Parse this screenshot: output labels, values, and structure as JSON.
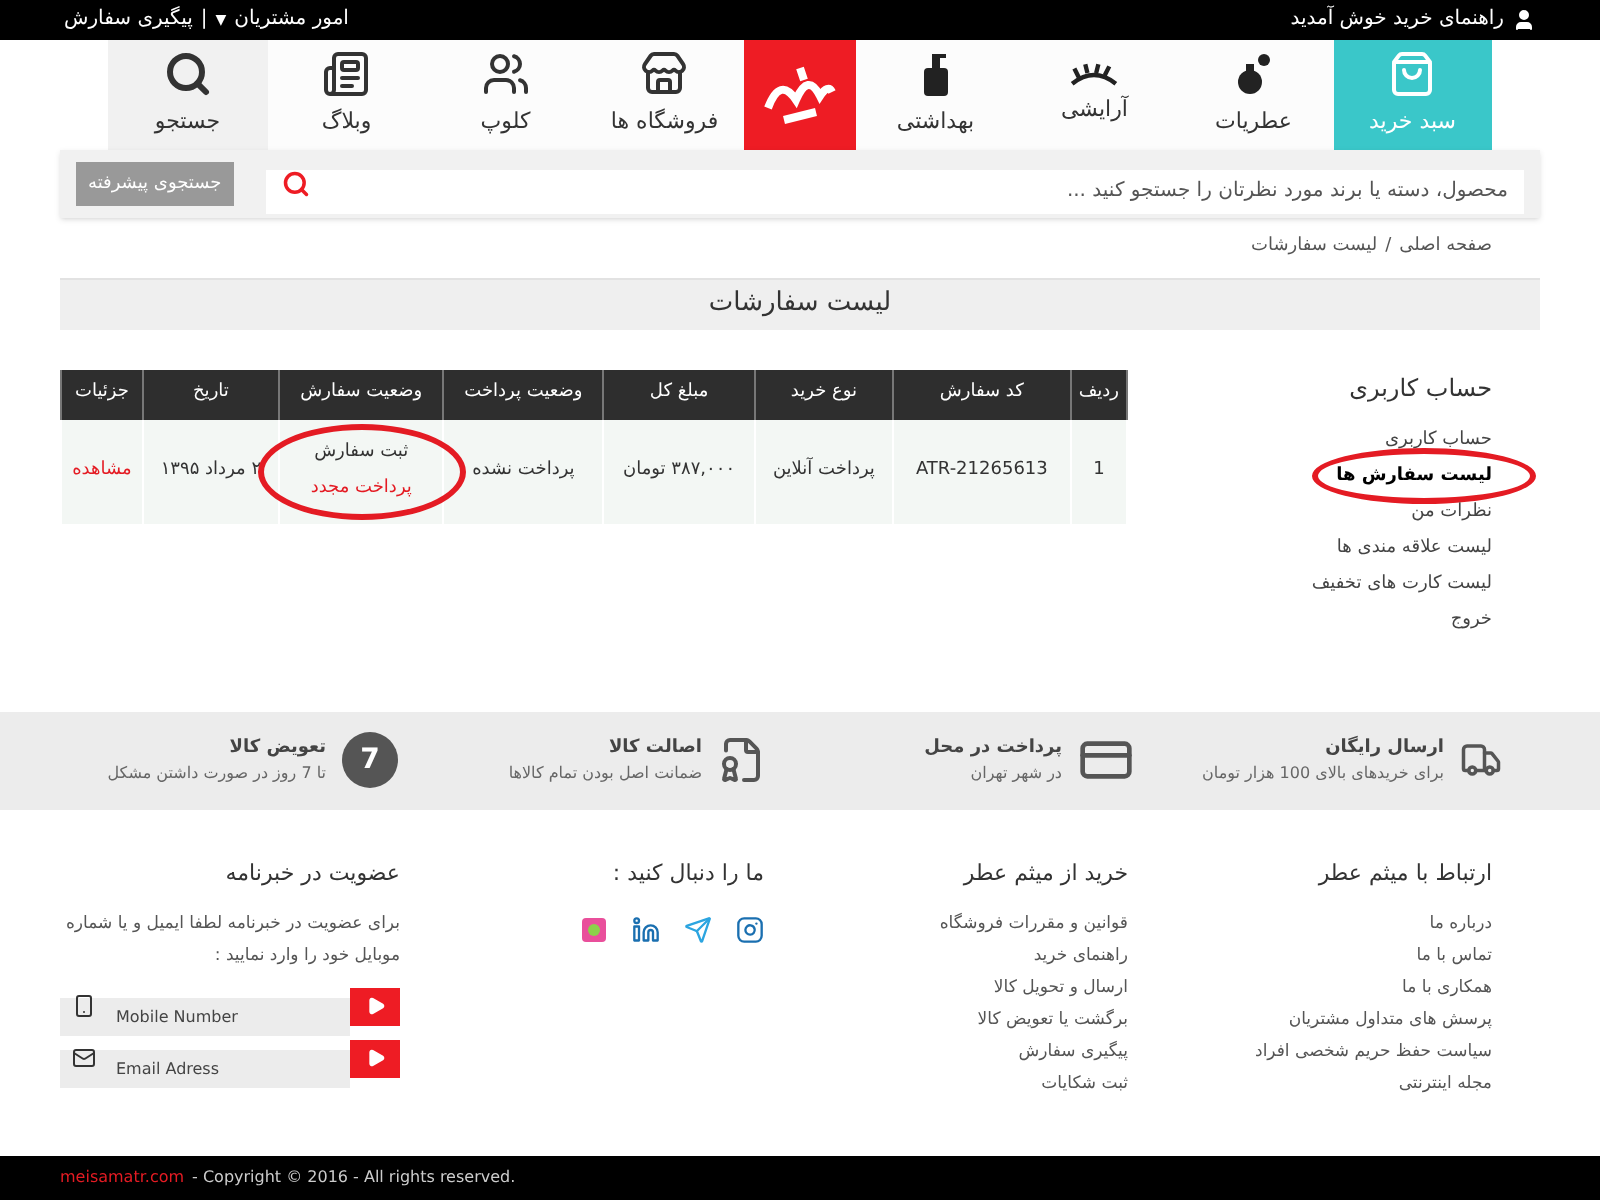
{
  "top_bar": {
    "welcome": "راهنمای خرید خوش آمدید",
    "menu": "امور مشتریان",
    "caret": "▼",
    "separator": "|",
    "track": "پیگیری سفارش"
  },
  "nav": [
    {
      "kind": "item",
      "label": "سبد خرید",
      "selected": true
    },
    {
      "kind": "item",
      "label": "عطریات",
      "selected": false
    },
    {
      "kind": "item",
      "label": "آرایشی",
      "selected": false
    },
    {
      "kind": "item",
      "label": "بهداشتی",
      "selected": false
    },
    {
      "kind": "logo"
    },
    {
      "kind": "item",
      "label": "فروشگاه ها",
      "selected": false
    },
    {
      "kind": "item",
      "label": "کلوپ",
      "selected": false
    },
    {
      "kind": "item",
      "label": "وبلاگ",
      "selected": false
    },
    {
      "kind": "item",
      "label": "جستجو",
      "selected": false
    }
  ],
  "search": {
    "placeholder": "محصول، دسته یا برند مورد نظرتان را جستجو کنید ...",
    "advanced": "جستجوی پیشرفته"
  },
  "breadcrumb": {
    "home": "صفحه اصلی",
    "separator": "/",
    "current": "لیست سفارشات"
  },
  "page_title": "لیست سفارشات",
  "table": {
    "columns": [
      "ردیف",
      "کد سفارش",
      "نوع خرید",
      "مبلغ کل",
      "وضعیت پرداخت",
      "وضعیت سفارش",
      "تاریخ",
      "جزئیات"
    ],
    "rows": [
      {
        "index": "1",
        "code": "ATR-21265613",
        "type": "پرداخت آنلاین",
        "total": "۳۸۷,۰۰۰ تومان",
        "payment": "پرداخت نشده",
        "status": "ثبت سفارش",
        "repay": "پرداخت مجدد",
        "date": "۲ مرداد ۱۳۹۵",
        "details": "مشاهده"
      }
    ]
  },
  "sidebar": {
    "title": "حساب کاربری",
    "items": [
      {
        "label": "حساب کاربری",
        "selected": false
      },
      {
        "label": "لیست سفارش ها",
        "selected": true
      },
      {
        "label": "نظرات من",
        "selected": false
      },
      {
        "label": "لیست علاقه مندی ها",
        "selected": false
      },
      {
        "label": "لیست کارت های تخفیف",
        "selected": false
      },
      {
        "label": "خروج",
        "selected": false
      }
    ]
  },
  "features": [
    {
      "title": "ارسال رایگان",
      "text": "برای خریدهای بالای 100 هزار تومان"
    },
    {
      "title": "پرداخت در محل",
      "text": "در شهر تهران"
    },
    {
      "title": "اصالت کالا",
      "text": "ضمانت اصل بودن تمام کالاها"
    },
    {
      "badge": "7",
      "title": "تعویض کالا",
      "text": "تا 7 روز در صورت داشتن مشکل"
    }
  ],
  "footer": {
    "columns": [
      {
        "title": "ارتباط با میثم عطر",
        "links": [
          "درباره ما",
          "تماس با ما",
          "همکاری با ما",
          "پرسش های متداول مشتریان",
          "سیاست حفظ حریم شخصی افراد",
          "مجله اینترنتی"
        ]
      },
      {
        "title": "خرید از میثم عطر",
        "links": [
          "قوانین و مقررات فروشگاه",
          "راهنمای خرید",
          "ارسال و تحویل کالا",
          "برگشت یا تعویض کالا",
          "پیگیری سفارش",
          "ثبت شکایات"
        ]
      }
    ],
    "social_title": "ما را دنبال کنید :",
    "newsletter": {
      "title": "عضویت در خبرنامه",
      "text": "برای عضویت در خبرنامه لطفا ایمیل و یا شماره موبایل خود را وارد نمایید :",
      "fields": [
        {
          "kind": "phone",
          "placeholder": "Mobile Number"
        },
        {
          "kind": "email",
          "placeholder": "Email Adress"
        }
      ]
    }
  },
  "copyright": {
    "site": "meisamatr.com",
    "text": "- Copyright © 2016 - All rights reserved."
  }
}
